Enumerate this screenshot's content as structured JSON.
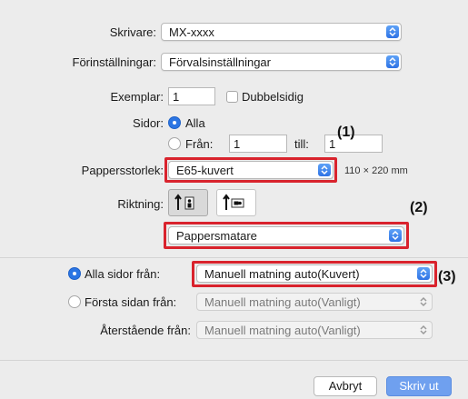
{
  "printer": {
    "label": "Skrivare:",
    "value": "MX-xxxx"
  },
  "presets": {
    "label": "Förinställningar:",
    "value": "Förvalsinställningar"
  },
  "copies": {
    "label": "Exemplar:",
    "value": "1",
    "duplex_label": "Dubbelsidig"
  },
  "pages": {
    "label": "Sidor:",
    "all_label": "Alla",
    "from_label": "Från:",
    "from_value": "1",
    "to_label": "till:",
    "to_value": "1"
  },
  "paper_size": {
    "label": "Pappersstorlek:",
    "value": "E65-kuvert",
    "dimensions": "110 × 220 mm"
  },
  "orientation": {
    "label": "Riktning:"
  },
  "section": {
    "value": "Pappersmatare"
  },
  "feed": {
    "all_pages_label": "Alla sidor från:",
    "all_pages_value": "Manuell matning auto(Kuvert)",
    "first_page_label": "Första sidan från:",
    "first_page_value": "Manuell matning auto(Vanligt)",
    "remaining_label": "Återstående från:",
    "remaining_value": "Manuell matning auto(Vanligt)"
  },
  "buttons": {
    "cancel": "Avbryt",
    "print": "Skriv ut"
  },
  "callouts": {
    "one": "(1)",
    "two": "(2)",
    "three": "(3)"
  },
  "colors": {
    "accent": "#2b75e3",
    "highlight": "#d9232d",
    "dialog_bg": "#ececec"
  }
}
